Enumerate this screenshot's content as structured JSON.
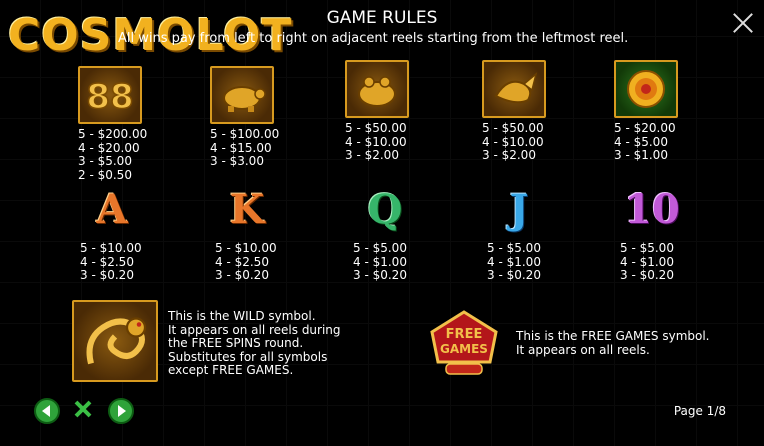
{
  "brand": "COSMOLOT",
  "title": "GAME RULES",
  "intro_text": "All wins pay from left to right on adjacent reels starting from the leftmost reel.",
  "symbols": [
    {
      "name": "88",
      "pays": [
        "5 - $200.00",
        "4 - $20.00",
        "3 - $5.00",
        "2 - $0.50"
      ]
    },
    {
      "name": "turtle",
      "pays": [
        "5 - $100.00",
        "4 - $15.00",
        "3 - $3.00"
      ]
    },
    {
      "name": "frog",
      "pays": [
        "5 - $50.00",
        "4 - $10.00",
        "3 - $2.00"
      ]
    },
    {
      "name": "koi",
      "pays": [
        "5 - $50.00",
        "4 - $10.00",
        "3 - $2.00"
      ]
    },
    {
      "name": "coin",
      "pays": [
        "5 - $20.00",
        "4 - $5.00",
        "3 - $1.00"
      ]
    },
    {
      "name": "A",
      "color": "#e8762a",
      "pays": [
        "5 - $10.00",
        "4 - $2.50",
        "3 - $0.20"
      ]
    },
    {
      "name": "K",
      "color": "#e8762a",
      "pays": [
        "5 - $10.00",
        "4 - $2.50",
        "3 - $0.20"
      ]
    },
    {
      "name": "Q",
      "color": "#36b56a",
      "pays": [
        "5 - $5.00",
        "4 - $1.00",
        "3 - $0.20"
      ]
    },
    {
      "name": "J",
      "color": "#3aa8e8",
      "pays": [
        "5 - $5.00",
        "4 - $1.00",
        "3 - $0.20"
      ]
    },
    {
      "name": "10",
      "color": "#c25ad8",
      "pays": [
        "5 - $5.00",
        "4 - $1.00",
        "3 - $0.20"
      ]
    }
  ],
  "wild": {
    "lines": [
      "This is the WILD symbol.",
      "It appears on all reels during",
      "the FREE SPINS round.",
      "Substitutes for all symbols",
      "except FREE GAMES."
    ]
  },
  "free_games": {
    "label_top": "FREE",
    "label_bottom": "GAMES",
    "lines": [
      "This is the FREE GAMES symbol.",
      "It appears on all reels."
    ]
  },
  "page": "Page 1/8",
  "nav": {
    "prev_icon": "arrow-left-icon",
    "close_icon": "x-icon",
    "next_icon": "arrow-right-icon"
  }
}
